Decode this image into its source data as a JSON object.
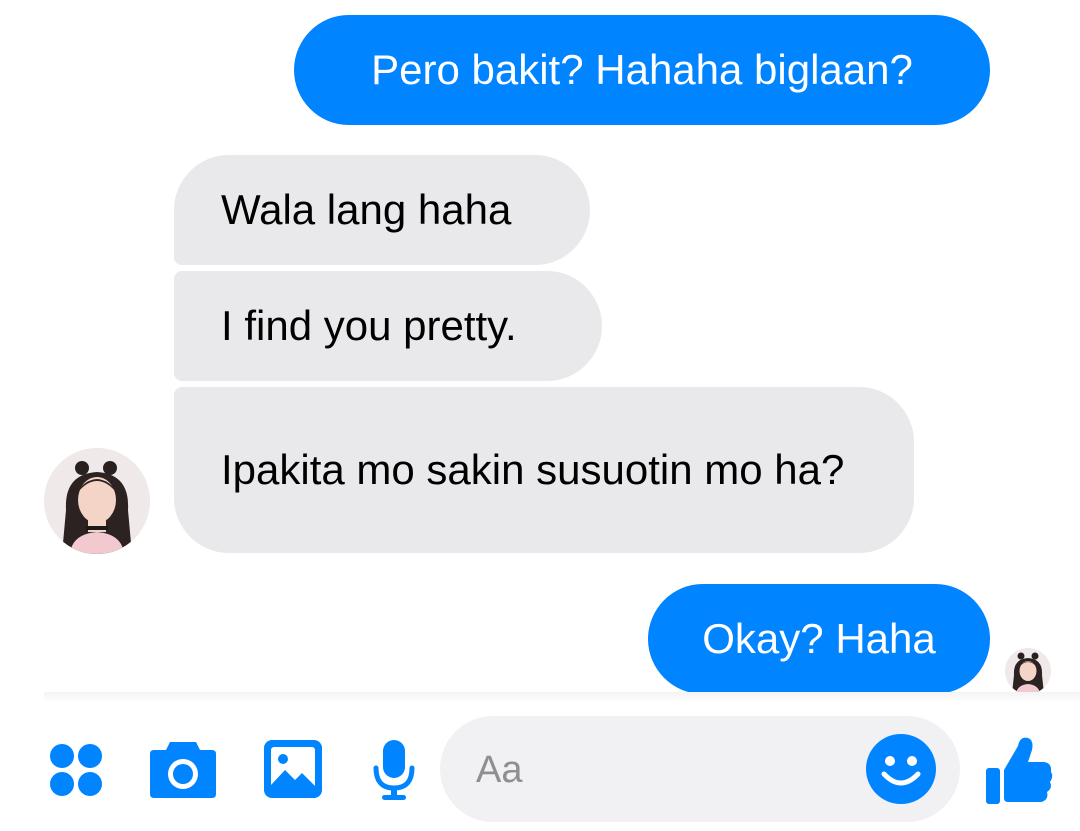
{
  "theme": {
    "accent": "#0084ff",
    "incoming_bubble": "#e9e9eb",
    "composer_bg": "#f1f1f3"
  },
  "messages": [
    {
      "direction": "outgoing",
      "text": "Pero bakit? Hahaha biglaan?"
    },
    {
      "direction": "incoming",
      "text": "Wala lang haha"
    },
    {
      "direction": "incoming",
      "text": "I find you pretty."
    },
    {
      "direction": "incoming",
      "text": "Ipakita mo sakin susuotin mo ha?"
    },
    {
      "direction": "outgoing",
      "text": "Okay? Haha"
    }
  ],
  "toolbar": {
    "icons": [
      "more-apps-icon",
      "camera-icon",
      "gallery-icon",
      "microphone-icon"
    ],
    "composer_placeholder": "Aa",
    "emoji_icon": "smiley-icon",
    "send_icon": "thumbs-up-icon"
  }
}
